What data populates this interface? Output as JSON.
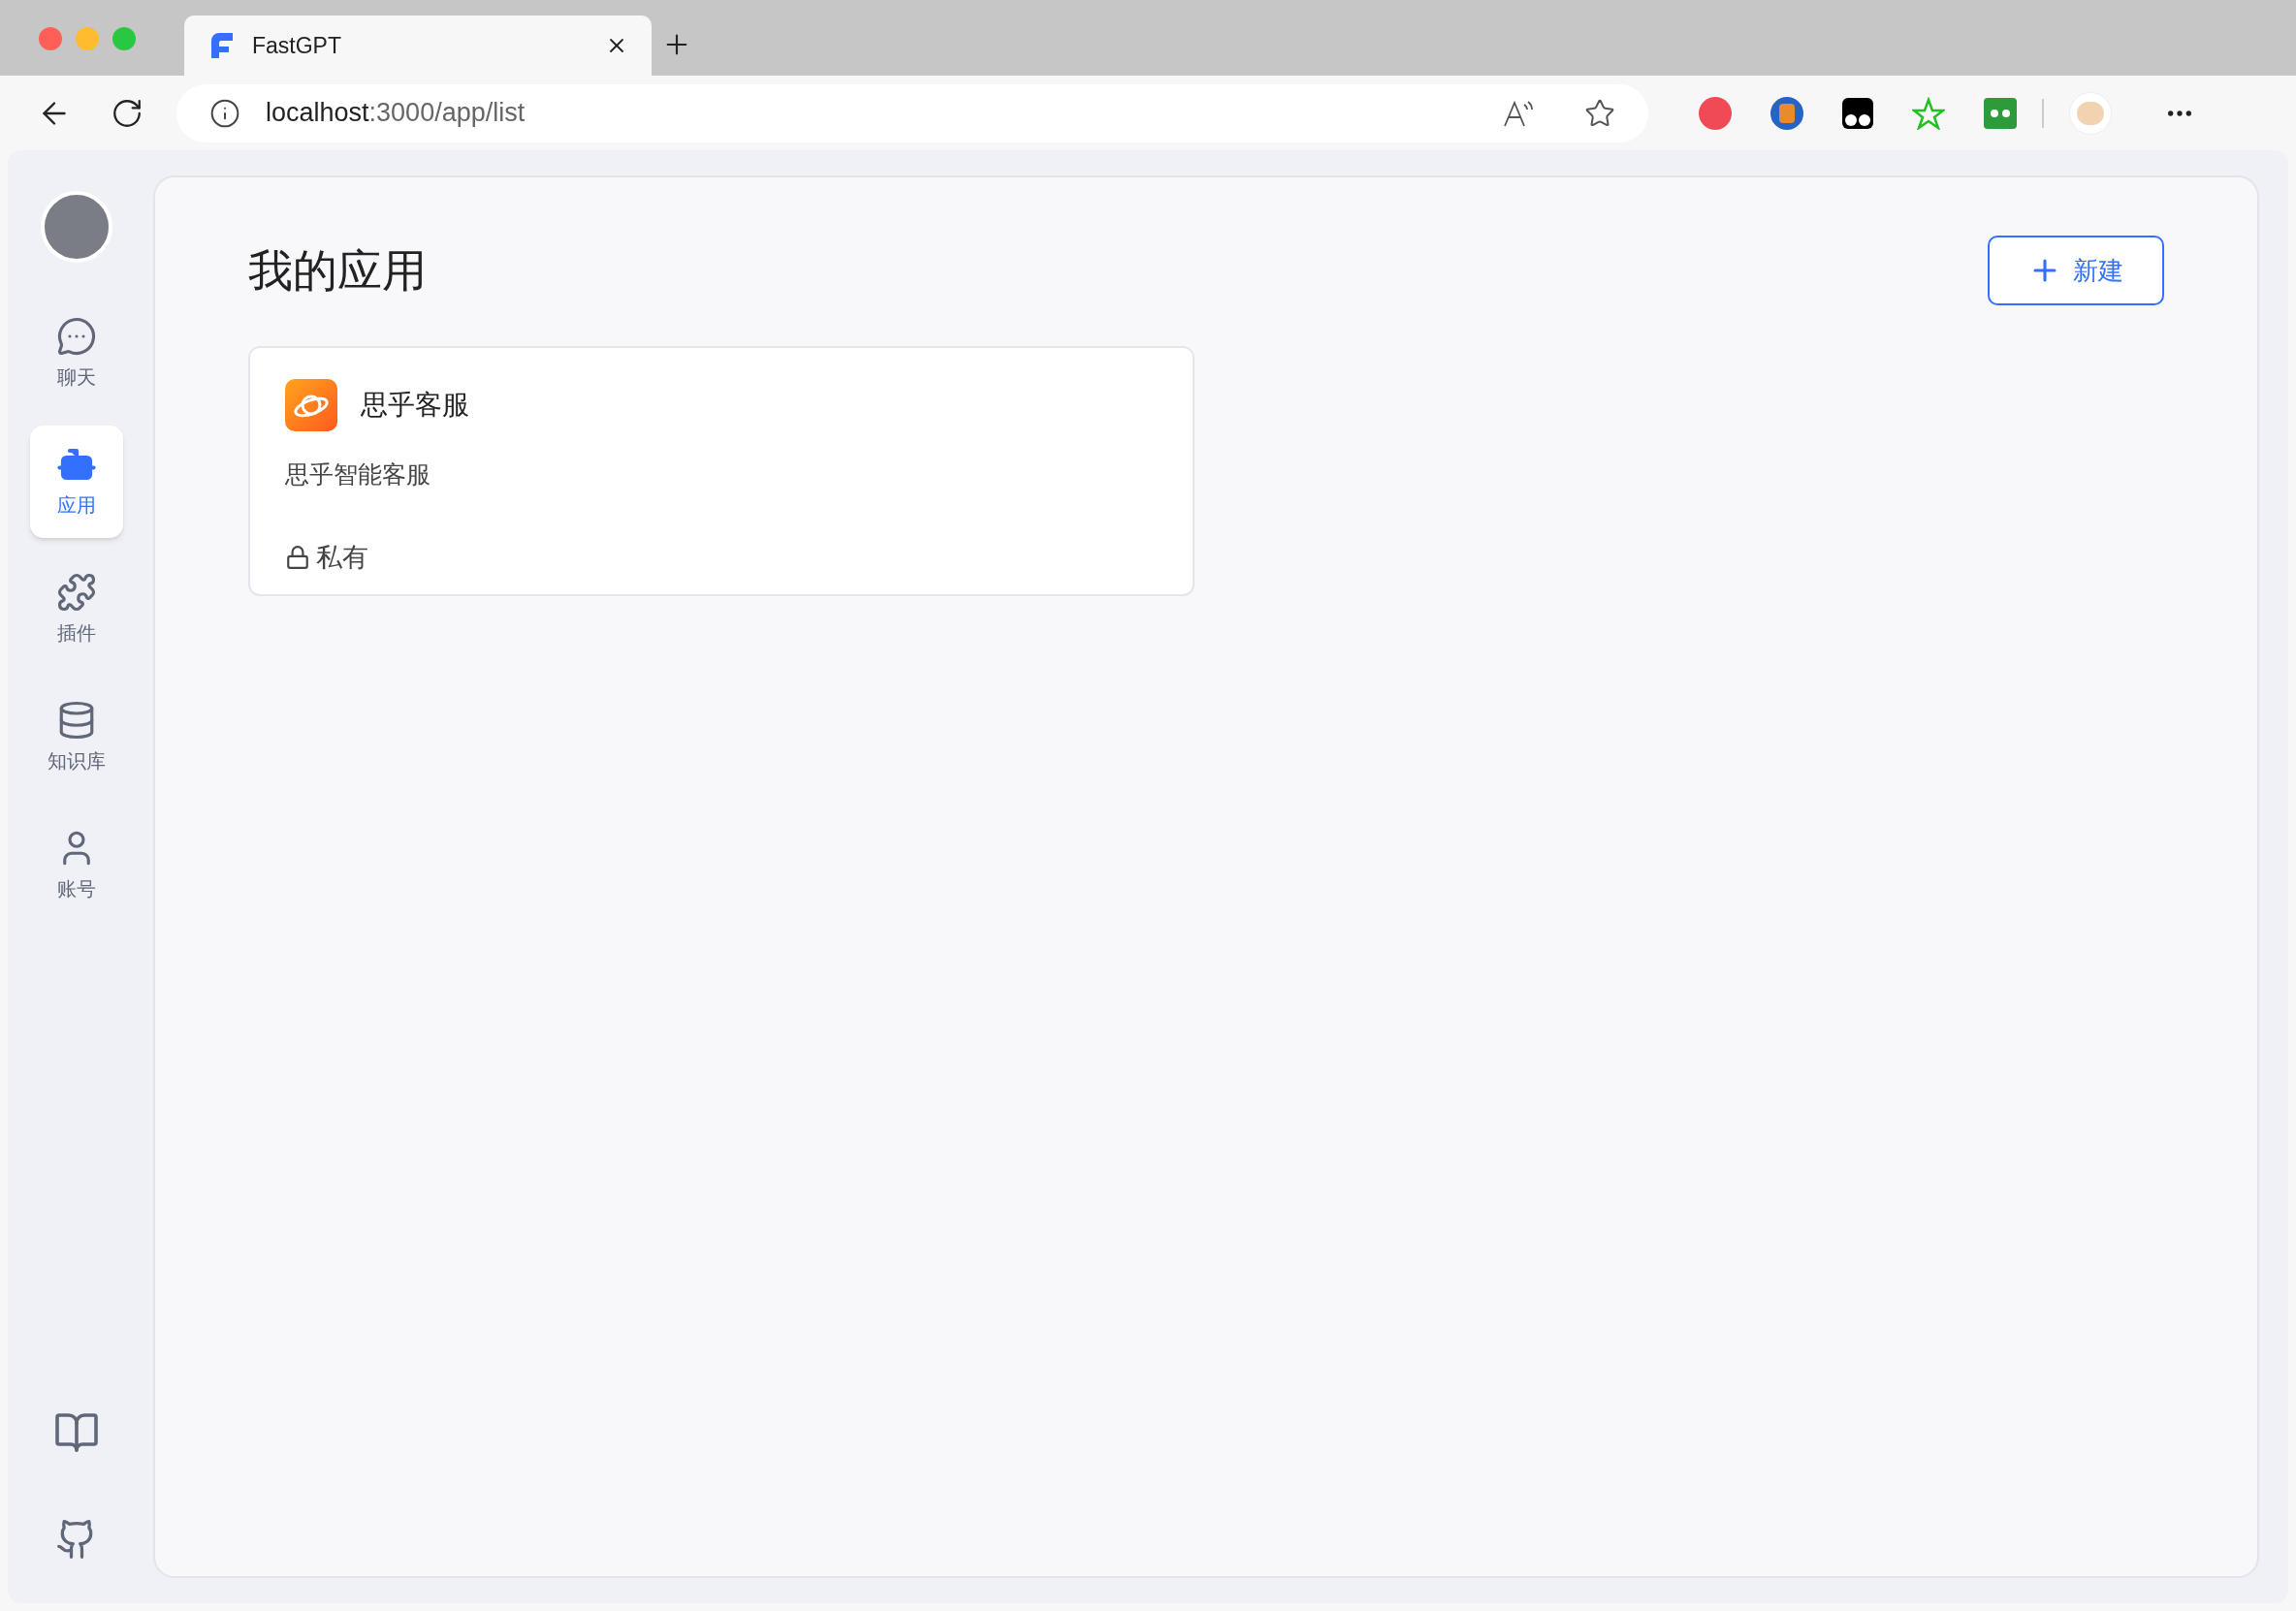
{
  "browser": {
    "tab_title": "FastGPT",
    "url_host": "localhost",
    "url_path": ":3000/app/list"
  },
  "sidebar": {
    "items": [
      {
        "kind": "chat",
        "label": "聊天",
        "selected": false
      },
      {
        "kind": "app",
        "label": "应用",
        "selected": true
      },
      {
        "kind": "plugin",
        "label": "插件",
        "selected": false
      },
      {
        "kind": "dataset",
        "label": "知识库",
        "selected": false
      },
      {
        "kind": "account",
        "label": "账号",
        "selected": false
      }
    ]
  },
  "page": {
    "title": "我的应用",
    "new_button": "新建"
  },
  "apps": [
    {
      "name": "思乎客服",
      "intro": "思乎智能客服",
      "permission": "私有"
    }
  ]
}
